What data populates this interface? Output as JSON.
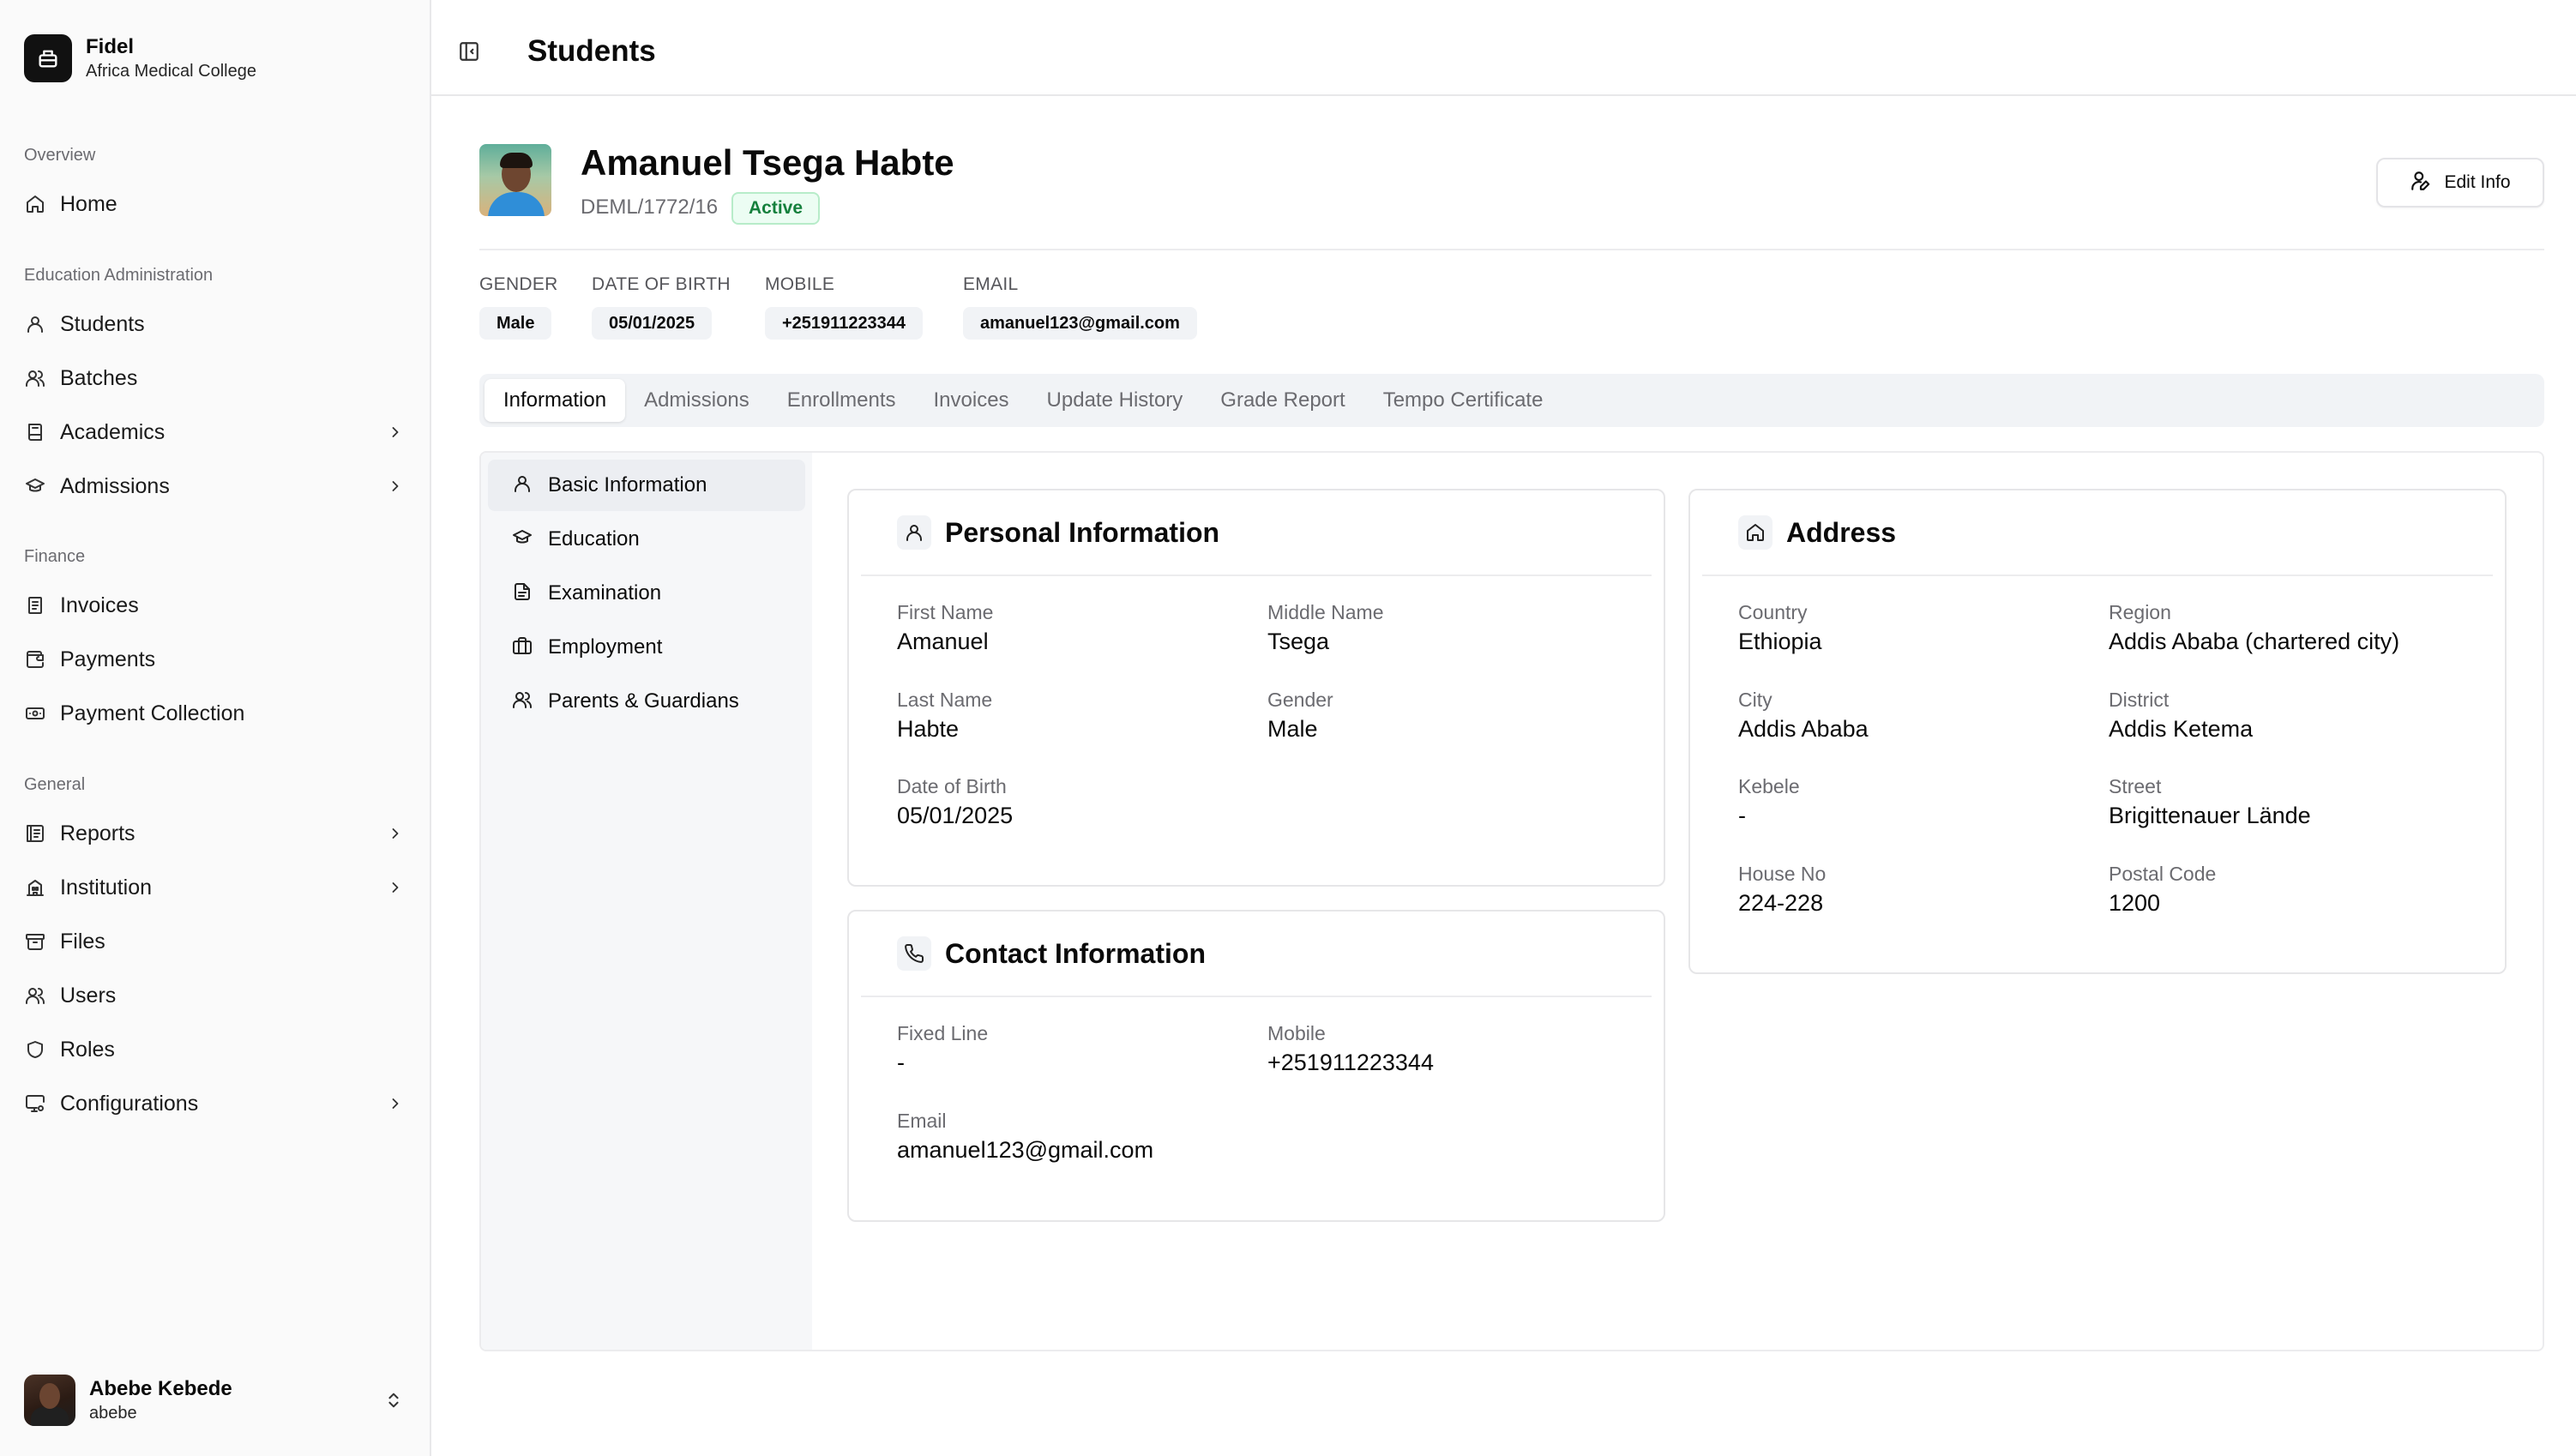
{
  "brand": {
    "name": "Fidel",
    "subtitle": "Africa Medical College"
  },
  "sidebar": {
    "groups": [
      {
        "label": "Overview"
      },
      {
        "label": "Education Administration"
      },
      {
        "label": "Finance"
      },
      {
        "label": "General"
      }
    ],
    "items": {
      "home": "Home",
      "students": "Students",
      "batches": "Batches",
      "academics": "Academics",
      "admissions": "Admissions",
      "invoices": "Invoices",
      "payments": "Payments",
      "payment_collection": "Payment Collection",
      "reports": "Reports",
      "institution": "Institution",
      "files": "Files",
      "users": "Users",
      "roles": "Roles",
      "configurations": "Configurations"
    },
    "user": {
      "name": "Abebe Kebede",
      "handle": "abebe"
    }
  },
  "header": {
    "title": "Students"
  },
  "profile": {
    "name": "Amanuel Tsega Habte",
    "student_id": "DEML/1772/16",
    "status": "Active",
    "edit_label": "Edit Info",
    "facts": {
      "gender": {
        "label": "GENDER",
        "value": "Male"
      },
      "dob": {
        "label": "DATE OF BIRTH",
        "value": "05/01/2025"
      },
      "mobile": {
        "label": "MOBILE",
        "value": "+251911223344"
      },
      "email": {
        "label": "EMAIL",
        "value": "amanuel123@gmail.com"
      }
    }
  },
  "tabs": [
    "Information",
    "Admissions",
    "Enrollments",
    "Invoices",
    "Update History",
    "Grade Report",
    "Tempo Certificate"
  ],
  "subnav": [
    "Basic Information",
    "Education",
    "Examination",
    "Employment",
    "Parents & Guardians"
  ],
  "personal": {
    "title": "Personal Information",
    "first_name": {
      "label": "First Name",
      "value": "Amanuel"
    },
    "middle_name": {
      "label": "Middle Name",
      "value": "Tsega"
    },
    "last_name": {
      "label": "Last Name",
      "value": "Habte"
    },
    "gender": {
      "label": "Gender",
      "value": "Male"
    },
    "dob": {
      "label": "Date of Birth",
      "value": "05/01/2025"
    }
  },
  "contact": {
    "title": "Contact Information",
    "fixed_line": {
      "label": "Fixed Line",
      "value": "-"
    },
    "mobile": {
      "label": "Mobile",
      "value": "+251911223344"
    },
    "email": {
      "label": "Email",
      "value": "amanuel123@gmail.com"
    }
  },
  "address": {
    "title": "Address",
    "country": {
      "label": "Country",
      "value": "Ethiopia"
    },
    "region": {
      "label": "Region",
      "value": "Addis Ababa (chartered city)"
    },
    "city": {
      "label": "City",
      "value": "Addis Ababa"
    },
    "district": {
      "label": "District",
      "value": "Addis Ketema"
    },
    "kebele": {
      "label": "Kebele",
      "value": "-"
    },
    "street": {
      "label": "Street",
      "value": "Brigittenauer Lände"
    },
    "house_no": {
      "label": "House No",
      "value": "224-228"
    },
    "postal_code": {
      "label": "Postal Code",
      "value": "1200"
    }
  },
  "colors": {
    "active_green": "#15803d",
    "muted": "#6b6b70",
    "tabs_bg": "#f1f3f6"
  }
}
